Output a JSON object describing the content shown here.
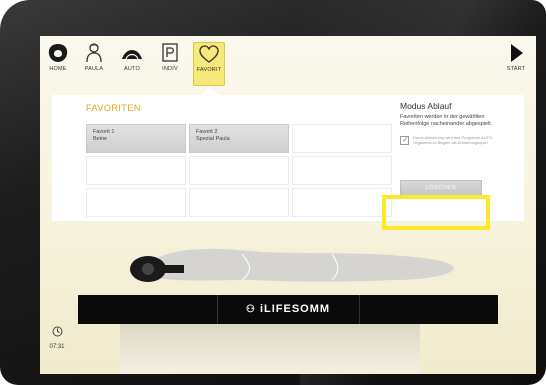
{
  "nav": {
    "items": [
      {
        "id": "home",
        "label": "HOME"
      },
      {
        "id": "paula",
        "label": "PAULA"
      },
      {
        "id": "auto",
        "label": "AUTO"
      },
      {
        "id": "indiv",
        "label": "INDIV"
      },
      {
        "id": "favorit",
        "label": "FAVORIT",
        "active": true
      }
    ],
    "start_label": "START"
  },
  "favorites": {
    "title": "FAVORITEN",
    "cells": [
      {
        "line1": "Favorit 1",
        "line2": "Beine",
        "filled": true
      },
      {
        "line1": "Favorit 2",
        "line2": "Spezial Paula",
        "filled": true
      },
      {
        "line1": "",
        "line2": "",
        "filled": false
      },
      {
        "line1": "",
        "line2": "",
        "filled": false
      },
      {
        "line1": "",
        "line2": "",
        "filled": false
      },
      {
        "line1": "",
        "line2": "",
        "filled": false
      },
      {
        "line1": "",
        "line2": "",
        "filled": false
      },
      {
        "line1": "",
        "line2": "",
        "filled": false
      },
      {
        "line1": "",
        "line2": "",
        "filled": false
      }
    ]
  },
  "modus": {
    "title": "Modus Ablauf",
    "description": "Favoriten werden in der gewählten Reihenfolge nacheinander abgespielt.",
    "checkbox_text": "Durch Aktivierung wird das Programm AUTO-Orgasmus zu Beginn als Erinnerungsspiel",
    "delete_label": "LÖSCHEN"
  },
  "footer": {
    "brand": "iLIFESOMM",
    "time": "07:31"
  },
  "colors": {
    "accent": "#e0a81e",
    "highlight": "#ffe82b",
    "active_tab": "#f6e87a"
  }
}
